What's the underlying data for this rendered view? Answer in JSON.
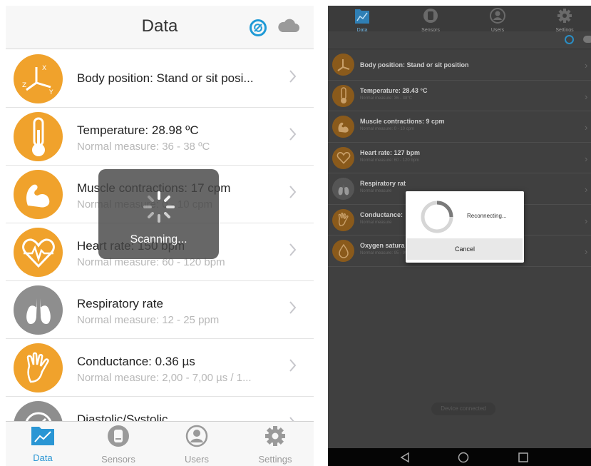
{
  "left": {
    "header": {
      "title": "Data",
      "sync_icon": "sync-icon",
      "cloud_icon": "cloud-icon"
    },
    "rows": [
      {
        "title": "Body position: Stand or sit posi...",
        "subtitle": "",
        "icon": "axes-icon",
        "color": "#f0a22c"
      },
      {
        "title": "Temperature: 28.98 ºC",
        "subtitle": "Normal measure: 36 - 38 ºC",
        "icon": "thermometer-icon",
        "color": "#f0a22c"
      },
      {
        "title": "Muscle contractions: 17 cpm",
        "subtitle": "Normal measure: 0 - 10 cpm",
        "icon": "muscle-icon",
        "color": "#f0a22c"
      },
      {
        "title": "Heart rate: 150 bpm",
        "subtitle": "Normal measure: 60 - 120 bpm",
        "icon": "heart-icon",
        "color": "#f0a22c"
      },
      {
        "title": "Respiratory rate",
        "subtitle": "Normal measure: 12 - 25 ppm",
        "icon": "lungs-icon",
        "color": "#8e8e8e"
      },
      {
        "title": "Conductance: 0.36 µs",
        "subtitle": "Normal measure: 2,00 - 7,00 µs / 1...",
        "icon": "hand-icon",
        "color": "#f0a22c"
      },
      {
        "title": "Diastolic/Systolic",
        "subtitle": "",
        "icon": "gauge-icon",
        "color": "#8e8e8e"
      }
    ],
    "overlay": {
      "label": "Scanning..."
    },
    "tabs": [
      {
        "label": "Data",
        "icon": "folder-chart-icon",
        "active": true
      },
      {
        "label": "Sensors",
        "icon": "sensor-icon",
        "active": false
      },
      {
        "label": "Users",
        "icon": "user-icon",
        "active": false
      },
      {
        "label": "Settings",
        "icon": "gear-icon",
        "active": false
      }
    ]
  },
  "right": {
    "tabs": [
      {
        "label": "Data",
        "icon": "folder-chart-icon",
        "active": true
      },
      {
        "label": "Sensors",
        "icon": "sensor-icon",
        "active": false
      },
      {
        "label": "Users",
        "icon": "user-icon",
        "active": false
      },
      {
        "label": "Settings",
        "icon": "gear-icon",
        "active": false
      }
    ],
    "rows": [
      {
        "title": "Body position: Stand or sit position",
        "subtitle": ""
      },
      {
        "title": "Temperature: 28.43 °C",
        "subtitle": "Normal measure: 36 - 38°C"
      },
      {
        "title": "Muscle contractions: 9 cpm",
        "subtitle": "Normal measure: 0 - 10 cpm"
      },
      {
        "title": "Heart rate: 127 bpm",
        "subtitle": "Normal measure: 60 - 120 bpm"
      },
      {
        "title": "Respiratory rat",
        "subtitle": "Normal measure"
      },
      {
        "title": "Conductance:",
        "subtitle": "Normal measure"
      },
      {
        "title": "Oxygen satura",
        "subtitle": "Normal measure: 95 - 99%"
      }
    ],
    "dialog": {
      "message": "Reconnecting...",
      "cancel_label": "Cancel"
    },
    "toast": "Device connected"
  }
}
